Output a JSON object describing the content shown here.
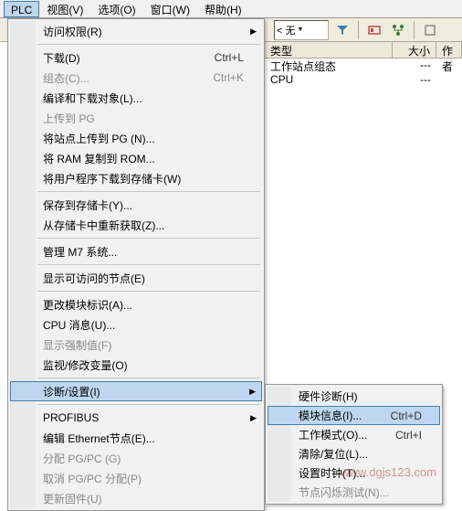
{
  "menubar": {
    "items": [
      {
        "label": "PLC"
      },
      {
        "label": "视图(V)"
      },
      {
        "label": "选项(O)"
      },
      {
        "label": "窗口(W)"
      },
      {
        "label": "帮助(H)"
      }
    ]
  },
  "toolbar": {
    "no_filter_placeholder": "< 无"
  },
  "table": {
    "headers": {
      "name": "类型",
      "size": "大小",
      "author": "作者"
    },
    "rows": [
      {
        "name": "工作站点组态",
        "size": "---"
      },
      {
        "name": "CPU",
        "size": "---"
      }
    ]
  },
  "dropdown": {
    "items": [
      {
        "label": "访问权限(R)",
        "arrow": true
      },
      {
        "sep": true
      },
      {
        "label": "下载(D)",
        "shortcut": "Ctrl+L"
      },
      {
        "label": "组态(C)...",
        "shortcut": "Ctrl+K",
        "disabled": true
      },
      {
        "label": "编译和下载对象(L)..."
      },
      {
        "label": "上传到 PG",
        "disabled": true
      },
      {
        "label": "将站点上传到 PG (N)..."
      },
      {
        "label": "将 RAM 复制到 ROM..."
      },
      {
        "label": "将用户程序下载到存储卡(W)"
      },
      {
        "sep": true
      },
      {
        "label": "保存到存储卡(Y)..."
      },
      {
        "label": "从存储卡中重新获取(Z)..."
      },
      {
        "sep": true
      },
      {
        "label": "管理 M7 系统..."
      },
      {
        "sep": true
      },
      {
        "label": "显示可访问的节点(E)"
      },
      {
        "sep": true
      },
      {
        "label": "更改模块标识(A)..."
      },
      {
        "label": "CPU 消息(U)..."
      },
      {
        "label": "显示强制值(F)",
        "disabled": true
      },
      {
        "label": "监视/修改变量(O)"
      },
      {
        "sep": true
      },
      {
        "label": "诊断/设置(I)",
        "arrow": true,
        "hover": true
      },
      {
        "sep": true
      },
      {
        "label": "PROFIBUS",
        "arrow": true
      },
      {
        "label": "编辑 Ethernet节点(E)..."
      },
      {
        "label": "分配 PG/PC (G)",
        "disabled": true
      },
      {
        "label": "取消 PG/PC 分配(P)",
        "disabled": true
      },
      {
        "label": "更新固件(U)",
        "disabled": true
      }
    ]
  },
  "submenu": {
    "items": [
      {
        "label": "硬件诊断(H)"
      },
      {
        "label": "模块信息(I)...",
        "shortcut": "Ctrl+D",
        "hover": true
      },
      {
        "label": "工作模式(O)...",
        "shortcut": "Ctrl+I"
      },
      {
        "label": "清除/复位(L)..."
      },
      {
        "label": "设置时钟(T)..."
      },
      {
        "label": "节点闪烁测试(N)...",
        "disabled": true
      }
    ]
  },
  "watermark": "www.dgjs123.com"
}
